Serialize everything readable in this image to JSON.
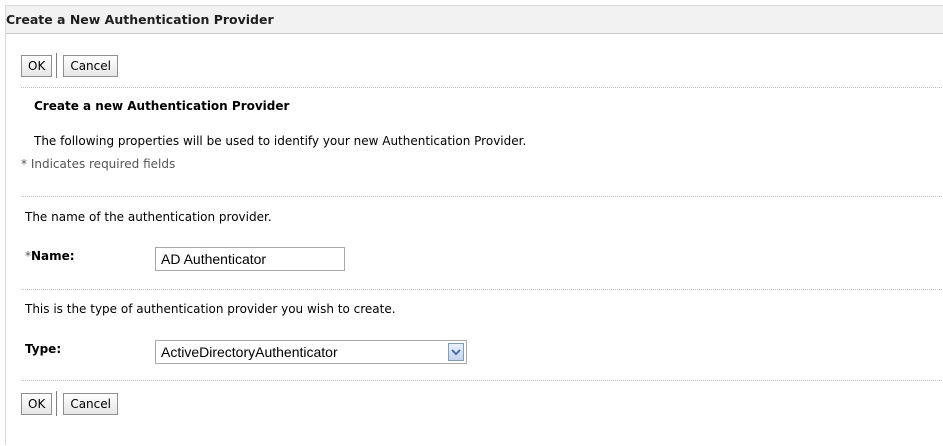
{
  "panel": {
    "title": "Create a New Authentication Provider"
  },
  "top_buttons": {
    "ok_label": "OK",
    "cancel_label": "Cancel"
  },
  "bottom_buttons": {
    "ok_label": "OK",
    "cancel_label": "Cancel"
  },
  "intro": {
    "heading": "Create a new Authentication Provider",
    "description": "The following properties will be used to identify your new Authentication Provider.",
    "required_note": "* Indicates required fields"
  },
  "name_field": {
    "help_text": "The name of the authentication provider.",
    "required_marker": "*",
    "label": "Name:",
    "value": "AD Authenticator"
  },
  "type_field": {
    "help_text": "This is the type of authentication provider you wish to create.",
    "label": "Type:",
    "selected_value": "ActiveDirectoryAuthenticator"
  },
  "icons": {
    "select_arrow": "chevron-down-icon"
  },
  "colors": {
    "header_bg": "#f2f2f2",
    "arrow_color": "#4d6fa8"
  }
}
